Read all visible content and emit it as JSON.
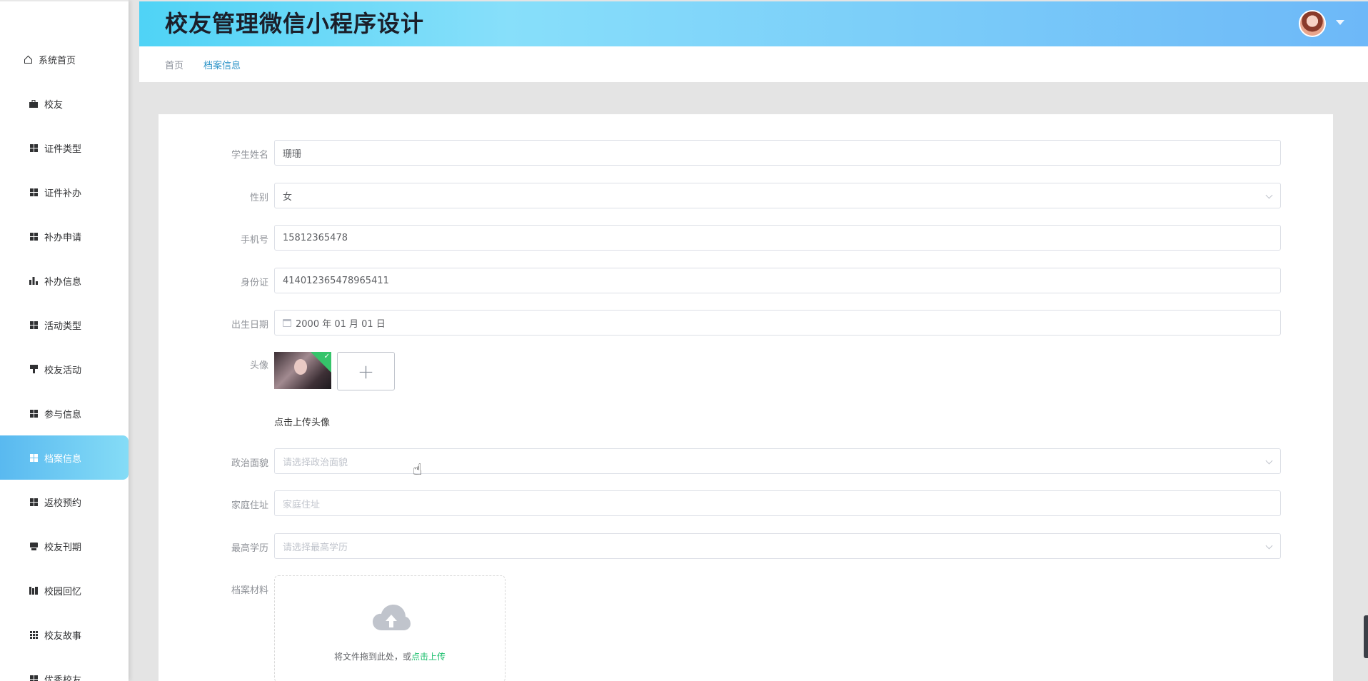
{
  "sidebar": {
    "items": [
      {
        "label": "系统首页",
        "icon": "home-icon"
      },
      {
        "label": "校友",
        "icon": "briefcase-icon"
      },
      {
        "label": "证件类型",
        "icon": "grid-icon"
      },
      {
        "label": "证件补办",
        "icon": "grid-icon"
      },
      {
        "label": "补办申请",
        "icon": "grid-icon"
      },
      {
        "label": "补办信息",
        "icon": "bar-chart-icon"
      },
      {
        "label": "活动类型",
        "icon": "grid-icon"
      },
      {
        "label": "校友活动",
        "icon": "stamp-icon"
      },
      {
        "label": "参与信息",
        "icon": "grid-icon"
      },
      {
        "label": "档案信息",
        "icon": "grid-icon",
        "active": true
      },
      {
        "label": "返校预约",
        "icon": "grid-icon"
      },
      {
        "label": "校友刊期",
        "icon": "print-icon"
      },
      {
        "label": "校园回忆",
        "icon": "library-icon"
      },
      {
        "label": "校友故事",
        "icon": "grid9-icon"
      },
      {
        "label": "优秀校友",
        "icon": "grid-icon"
      }
    ]
  },
  "header": {
    "title": "校友管理微信小程序设计",
    "avatar_icon": "user-avatar"
  },
  "breadcrumb": {
    "home": "首页",
    "current": "档案信息"
  },
  "form": {
    "name": {
      "label": "学生姓名",
      "value": "珊珊"
    },
    "gender": {
      "label": "性别",
      "value": "女"
    },
    "phone": {
      "label": "手机号",
      "value": "15812365478"
    },
    "id_card": {
      "label": "身份证",
      "value": "414012365478965411"
    },
    "birthday": {
      "label": "出生日期",
      "value": "2000 年 01 月 01 日"
    },
    "avatar": {
      "label": "头像",
      "add_symbol": "+",
      "hint": "点击上传头像"
    },
    "politics": {
      "label": "政治面貌",
      "placeholder": "请选择政治面貌"
    },
    "address": {
      "label": "家庭住址",
      "placeholder": "家庭住址"
    },
    "education": {
      "label": "最高学历",
      "placeholder": "请选择最高学历"
    },
    "files": {
      "label": "档案材料",
      "drop_text": "将文件拖到此处，或",
      "drop_link": "点击上传"
    }
  },
  "colors": {
    "accent": "#2f95c8",
    "active_menu_start": "#59b9f0",
    "active_menu_end": "#85dcf6",
    "upload_link": "#19be6b"
  }
}
